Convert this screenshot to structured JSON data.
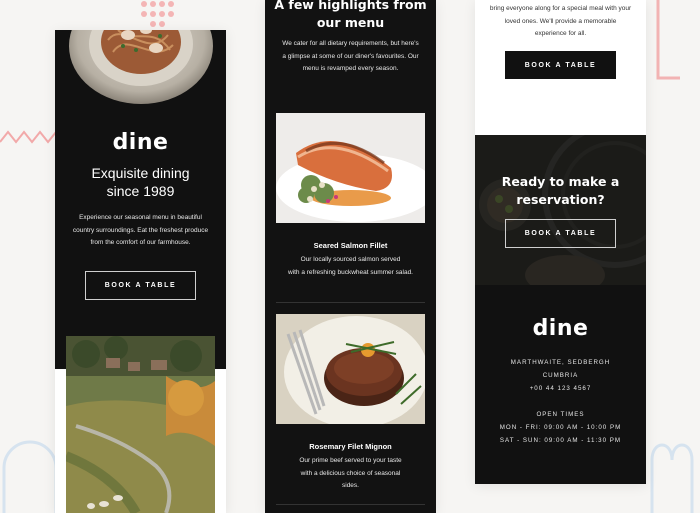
{
  "phone1": {
    "brand": "dine",
    "tagline": [
      "Exquisite dining",
      "since 1989"
    ],
    "intro": [
      "Experience our seasonal menu in beautiful",
      "country surroundings. Eat the freshest produce",
      "from the comfort of our farmhouse."
    ],
    "button": "BOOK A TABLE"
  },
  "phone2": {
    "title": [
      "A few highlights from",
      "our menu"
    ],
    "intro": [
      "We cater for all dietary requirements, but here's",
      "a glimpse at some of our diner's favourites. Our",
      "menu is revamped every season."
    ],
    "dishes": [
      {
        "name": "Seared Salmon Fillet",
        "desc": [
          "Our locally sourced salmon served",
          "with a refreshing buckwheat summer salad."
        ]
      },
      {
        "name": "Rosemary Filet Mignon",
        "desc": [
          "Our prime beef served to your taste",
          "with a delicious choice of seasonal",
          "sides."
        ]
      }
    ]
  },
  "phone3": {
    "top_text": [
      "bring everyone along for a special meal with your",
      "loved ones. We'll provide a memorable",
      "experience for all."
    ],
    "button_top": "BOOK A TABLE",
    "reserve_title": [
      "Ready to make a",
      "reservation?"
    ],
    "button_reserve": "BOOK A TABLE",
    "brand": "dine",
    "address": [
      "MARTHWAITE, SEDBERGH",
      "CUMBRIA",
      "+00 44 123 4567"
    ],
    "hours": [
      "OPEN TIMES",
      "MON - FRI: 09:00 AM - 10:00 PM",
      "SAT - SUN: 09:00 AM - 11:30 PM"
    ]
  },
  "colors": {
    "background": "#f6f5f3",
    "dark": "#111111",
    "accent_pink": "#f2a9a9",
    "accent_blue": "#d6e3ef"
  }
}
